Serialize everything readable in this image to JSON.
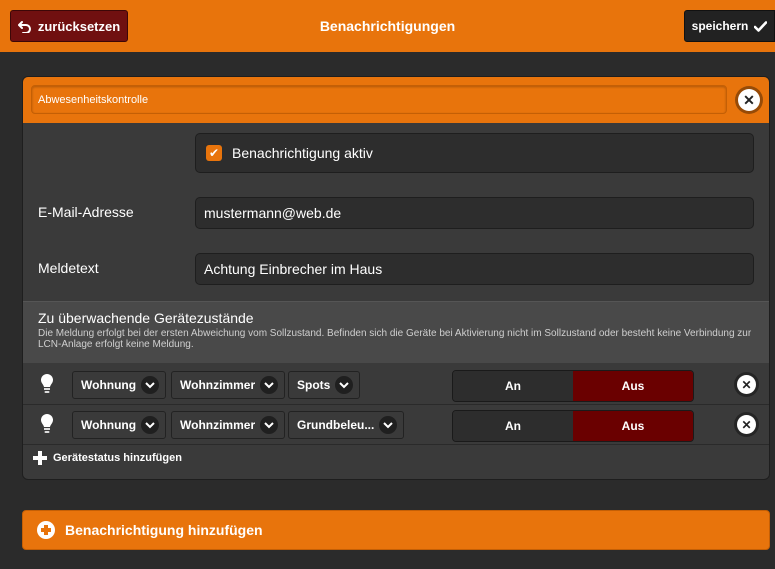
{
  "header": {
    "back_label": "zurücksetzen",
    "title": "Benachrichtigungen",
    "save_label": "speichern"
  },
  "notification": {
    "name_value": "Abwesenheitskontrolle",
    "active_label": "Benachrichtigung aktiv",
    "active_checked": true,
    "email_label": "E-Mail-Adresse",
    "email_value": "mustermann@web.de",
    "message_label": "Meldetext",
    "message_value": "Achtung Einbrecher im Haus"
  },
  "monitoring": {
    "title": "Zu überwachende Gerätezustände",
    "description": "Die Meldung erfolgt bei der ersten Abweichung vom Sollzustand. Befinden sich die Geräte bei Aktivierung nicht im Sollzustand oder besteht keine Verbindung zur LCN-Anlage erfolgt keine Meldung.",
    "rows": [
      {
        "selects": [
          "Wohnung",
          "Wohnzimmer",
          "Spots"
        ],
        "on_label": "An",
        "off_label": "Aus",
        "selected": "off"
      },
      {
        "selects": [
          "Wohnung",
          "Wohnzimmer",
          "Grundbeleu..."
        ],
        "on_label": "An",
        "off_label": "Aus",
        "selected": "off"
      }
    ],
    "add_status_label": "Gerätestatus hinzufügen"
  },
  "add_notification_label": "Benachrichtigung hinzufügen",
  "colors": {
    "accent": "#e8740c",
    "background": "#2b2b2b",
    "panel": "#3a3a3a",
    "off_selected": "#6a0000",
    "back_button": "#701010"
  },
  "icons": {
    "back": "undo-arrow-icon",
    "save": "checkmark-icon",
    "close": "close-circle-icon",
    "device": "lightbulb-icon",
    "dropdown": "chevron-down-icon",
    "add": "plus-icon"
  }
}
